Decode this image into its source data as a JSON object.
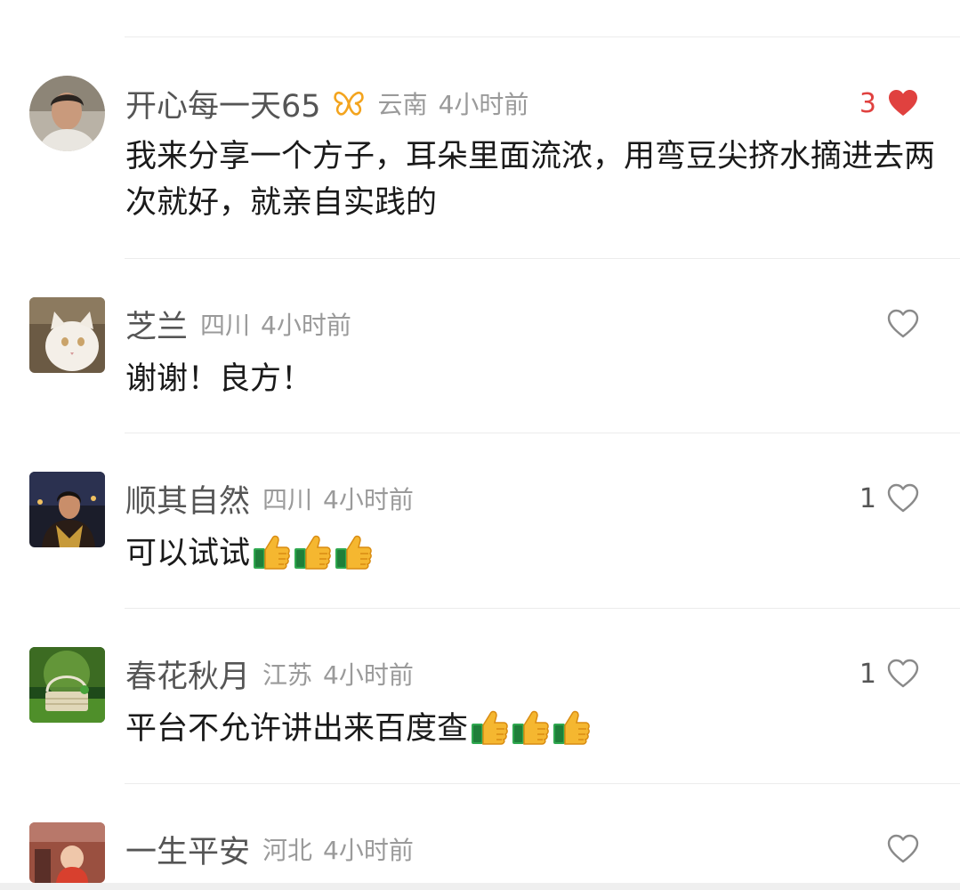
{
  "colors": {
    "accent_red": "#e0413f",
    "name_gray": "#555555",
    "meta_gray": "#9a9a9a"
  },
  "comments": [
    {
      "username": "开心每一天65",
      "badge": "butterfly-badge-icon",
      "location": "云南",
      "time": "4小时前",
      "text": "我来分享一个方子，耳朵里面流浓，用弯豆尖挤水摘进去两次就好，就亲自实践的",
      "like_count": "3",
      "liked": true
    },
    {
      "username": "芝兰",
      "location": "四川",
      "time": "4小时前",
      "text": "谢谢！良方！",
      "like_count": "",
      "liked": false
    },
    {
      "username": "顺其自然",
      "location": "四川",
      "time": "4小时前",
      "text": "可以试试",
      "emoji": "thumbs-up-icon",
      "emoji_count": 3,
      "like_count": "1",
      "liked": false
    },
    {
      "username": "春花秋月",
      "location": "江苏",
      "time": "4小时前",
      "text": "平台不允许讲出来百度查",
      "emoji": "thumbs-up-icon",
      "emoji_count": 3,
      "like_count": "1",
      "liked": false
    },
    {
      "username": "一生平安",
      "location": "河北",
      "time": "4小时前",
      "text": "",
      "like_count": "",
      "liked": false
    }
  ]
}
